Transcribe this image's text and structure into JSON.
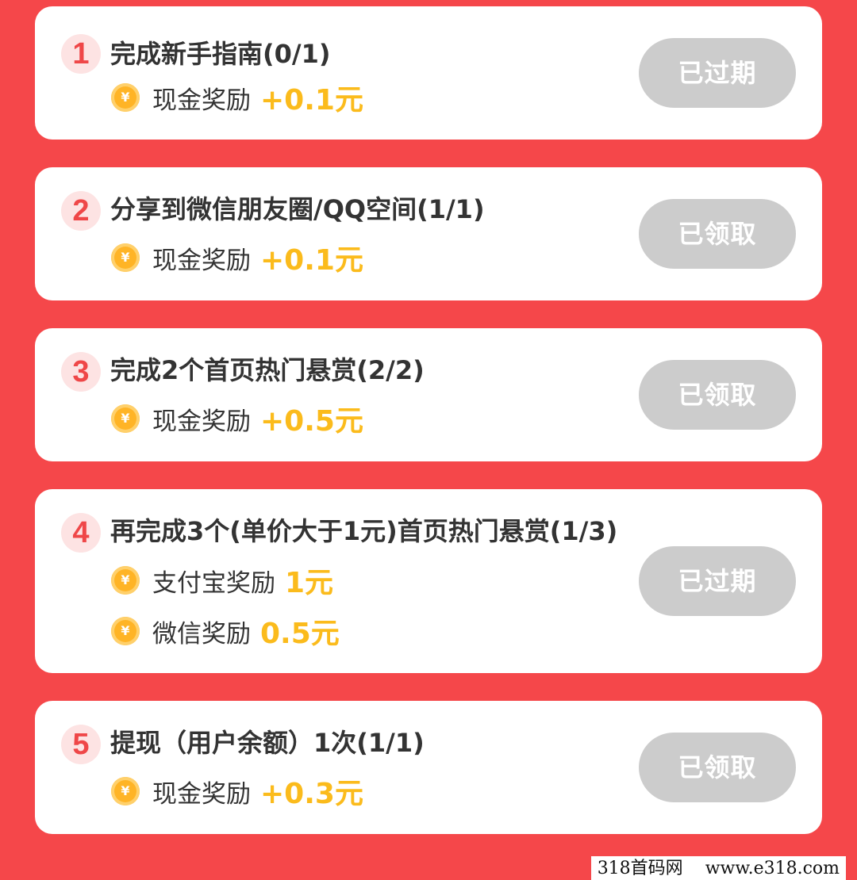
{
  "tasks": [
    {
      "number": "1",
      "title": "完成新手指南(0/1)",
      "rewards": [
        {
          "label": "现金奖励",
          "amount": "+0.1元"
        }
      ],
      "status": "已过期"
    },
    {
      "number": "2",
      "title": "分享到微信朋友圈/QQ空间(1/1)",
      "rewards": [
        {
          "label": "现金奖励",
          "amount": "+0.1元"
        }
      ],
      "status": "已领取"
    },
    {
      "number": "3",
      "title": "完成2个首页热门悬赏(2/2)",
      "rewards": [
        {
          "label": "现金奖励",
          "amount": "+0.5元"
        }
      ],
      "status": "已领取"
    },
    {
      "number": "4",
      "title": "再完成3个(单价大于1元)首页热门悬赏(1/3)",
      "rewards": [
        {
          "label": "支付宝奖励",
          "amount": "1元"
        },
        {
          "label": "微信奖励",
          "amount": "0.5元"
        }
      ],
      "status": "已过期"
    },
    {
      "number": "5",
      "title": "提现（用户余额）1次(1/1)",
      "rewards": [
        {
          "label": "现金奖励",
          "amount": "+0.3元"
        }
      ],
      "status": "已领取"
    }
  ],
  "coin_symbol": "¥",
  "watermark": {
    "site_name": "318首码网",
    "url": "www.e318.com"
  },
  "colors": {
    "background": "#f5474a",
    "badge_text": "#ef4748",
    "reward_amount": "#fbbb1c",
    "disabled_button": "#cccccc"
  }
}
